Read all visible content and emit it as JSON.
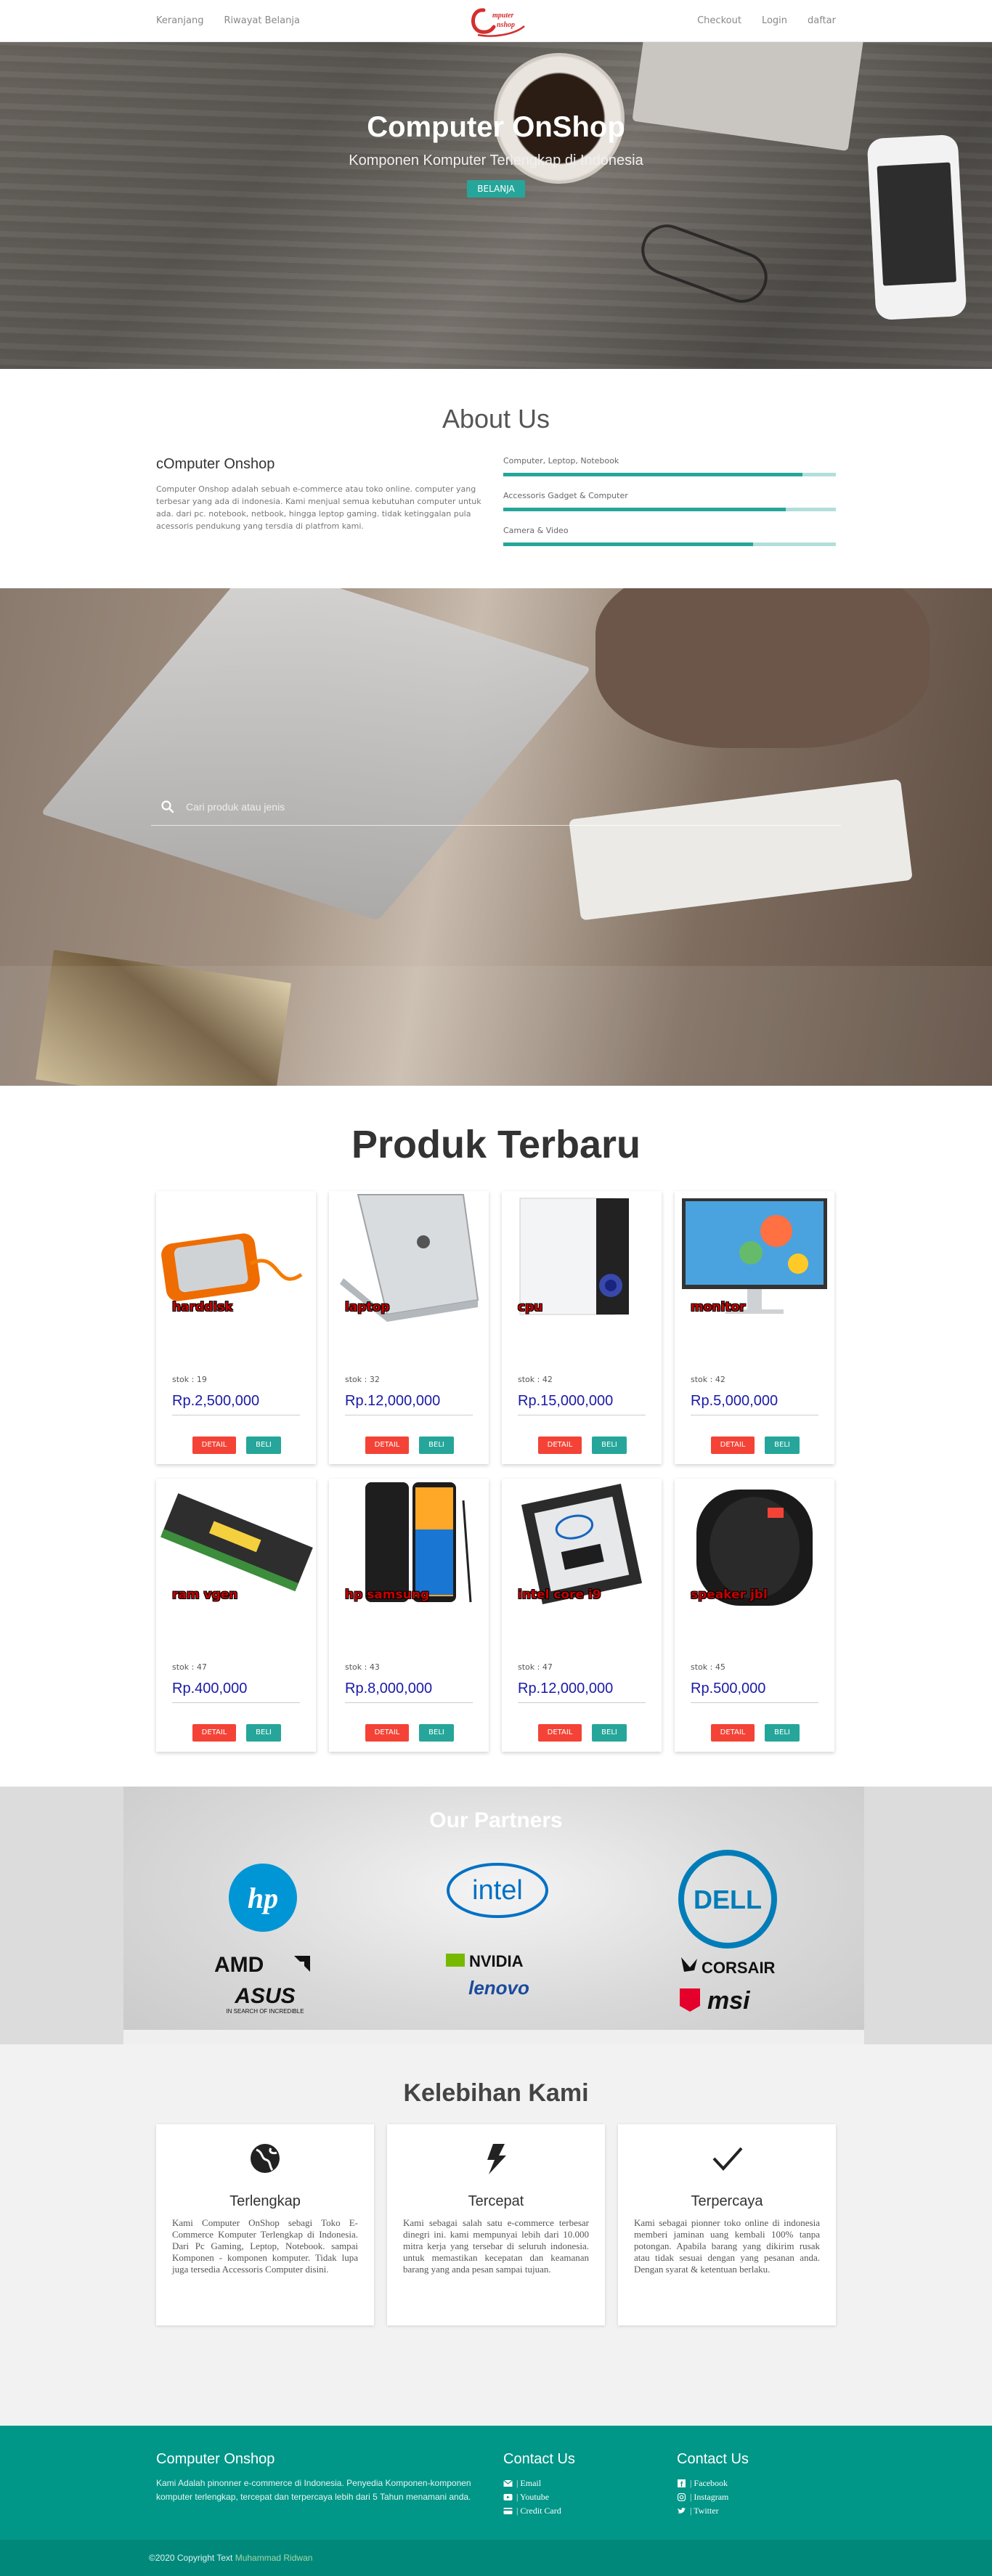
{
  "nav": {
    "left": [
      "Keranjang",
      "Riwayat Belanja"
    ],
    "right": [
      "Checkout",
      "Login",
      "daftar"
    ],
    "logo_text": "Computer Onshop",
    "logo_color": "#d32f2f"
  },
  "hero": {
    "title": "Computer OnShop",
    "subtitle": "Komponen Komputer Terlengkap di Indonesia",
    "button": "BELANJA"
  },
  "about": {
    "title": "About Us",
    "heading": "cOmputer Onshop",
    "text": "Computer Onshop adalah sebuah e-commerce atau toko online. computer yang terbesar yang ada di indonesia. Kami menjual semua kebutuhan computer untuk ada. dari pc. notebook, netbook, hingga leptop gaming. tidak ketinggalan pula acessoris pendukung yang tersdia di platfrom kami.",
    "skills": [
      {
        "label": "Computer, Leptop, Notebook",
        "level": 0.9
      },
      {
        "label": "Accessoris Gadget & Computer",
        "level": 0.85
      },
      {
        "label": "Camera & Video",
        "level": 0.75
      }
    ]
  },
  "search": {
    "placeholder": "Cari produk atau jenis"
  },
  "products": {
    "title": "Produk Terbaru",
    "detail_label": "DETAIL",
    "buy_label": "BELI",
    "items": [
      {
        "name": "harddisk",
        "stock": "stok : 19",
        "price": "Rp.2,500,000",
        "icon": "harddisk-image"
      },
      {
        "name": "laptop",
        "stock": "stok : 32",
        "price": "Rp.12,000,000",
        "icon": "laptop-image"
      },
      {
        "name": "cpu",
        "stock": "stok : 42",
        "price": "Rp.15,000,000",
        "icon": "cpu-case-image"
      },
      {
        "name": "monitor",
        "stock": "stok : 42",
        "price": "Rp.5,000,000",
        "icon": "monitor-image"
      },
      {
        "name": "ram vgen",
        "stock": "stok : 47",
        "price": "Rp.400,000",
        "icon": "ram-image"
      },
      {
        "name": "hp samsung",
        "stock": "stok : 43",
        "price": "Rp.8,000,000",
        "icon": "smartphone-image"
      },
      {
        "name": "intel core i9",
        "stock": "stok : 47",
        "price": "Rp.12,000,000",
        "icon": "processor-image"
      },
      {
        "name": "speaker jbl",
        "stock": "stok : 45",
        "price": "Rp.500,000",
        "icon": "speaker-image"
      }
    ]
  },
  "partners": {
    "title": "Our Partners",
    "logos": [
      "hp",
      "intel",
      "DELL",
      "AMD",
      "NVIDIA",
      "CORSAIR",
      "ASUS",
      "lenovo",
      "msi"
    ],
    "asus_tagline": "IN SEARCH OF INCREDIBLE"
  },
  "advantages": {
    "title": "Kelebihan Kami",
    "items": [
      {
        "icon": "globe-icon",
        "heading": "Terlengkap",
        "text": "Kami Computer OnShop sebagi Toko E-Commerce Komputer Terlengkap di Indonesia. Dari Pc Gaming, Leptop, Notebook. sampai Komponen - komponen komputer. Tidak lupa juga tersedia Accessoris Computer disini."
      },
      {
        "icon": "lightning-icon",
        "heading": "Tercepat",
        "text": "Kami sebagai salah satu e-commerce terbesar dinegri ini. kami mempunyai lebih dari 10.000 mitra kerja yang tersebar di seluruh indonesia. untuk memastikan kecepatan dan keamanan barang yang anda pesan sampai tujuan."
      },
      {
        "icon": "checkmark-icon",
        "heading": "Terpercaya",
        "text": "Kami sebagai pionner toko online di indonesia memberi jaminan uang kembali 100% tanpa potongan. Apabila barang yang dikirim rusak atau tidak sesuai dengan yang pesanan anda. Dengan syarat & ketentuan berlaku."
      }
    ]
  },
  "footer": {
    "brand": "Computer Onshop",
    "description": "Kami Adalah pinonner e-commerce di Indonesia. Penyedia Komponen-komponen komputer terlengkap, tercepat dan terpercaya lebih dari 5 Tahun menamani anda.",
    "contact1": {
      "title": "Contact Us",
      "links": [
        "| Email",
        "| Youtube",
        "| Credit Card"
      ]
    },
    "contact2": {
      "title": "Contact Us",
      "links": [
        "| Facebook",
        "| Instagram",
        "| Twitter"
      ]
    },
    "copyright": "©2020 Copyright Text",
    "author": "Muhammad Ridwan"
  },
  "colors": {
    "teal": "#26a69a",
    "footer": "#009688",
    "danger": "#f44336",
    "price": "#1a1aa8"
  }
}
